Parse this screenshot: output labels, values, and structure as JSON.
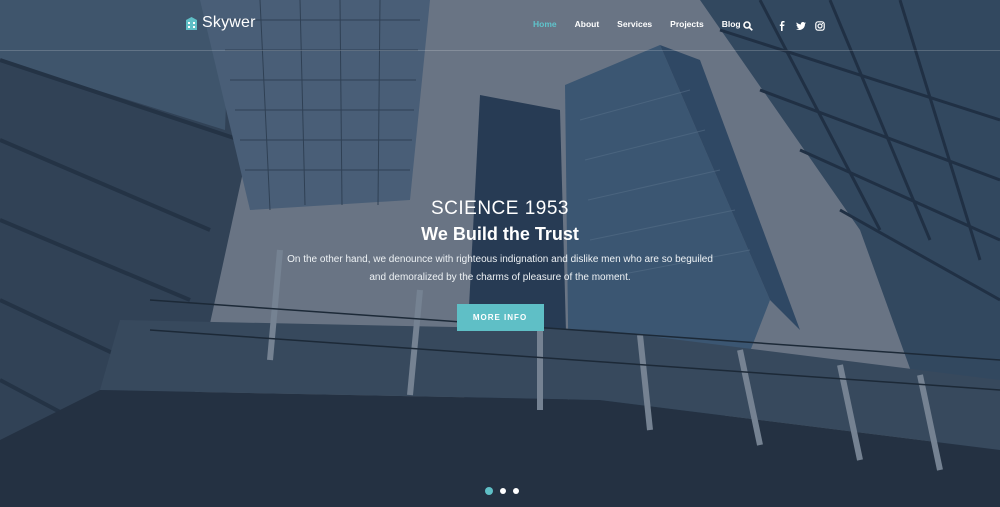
{
  "brand": {
    "name": "Skywer",
    "accent": "#5fbfc6"
  },
  "nav": {
    "items": [
      {
        "label": "Home",
        "active": true
      },
      {
        "label": "About",
        "active": false
      },
      {
        "label": "Services",
        "active": false
      },
      {
        "label": "Projects",
        "active": false
      },
      {
        "label": "Blog",
        "active": false
      }
    ],
    "icons": [
      "search-icon",
      "facebook-icon",
      "twitter-icon",
      "instagram-icon"
    ]
  },
  "hero": {
    "subtitle": "SCIENCE 1953",
    "title": "We Build the Trust",
    "description": "On the other hand, we denounce with righteous indignation and dislike men who are so beguiled and demoralized by the charms of pleasure of the moment.",
    "cta_label": "MORE INFO"
  },
  "slider": {
    "count": 3,
    "active_index": 0
  }
}
